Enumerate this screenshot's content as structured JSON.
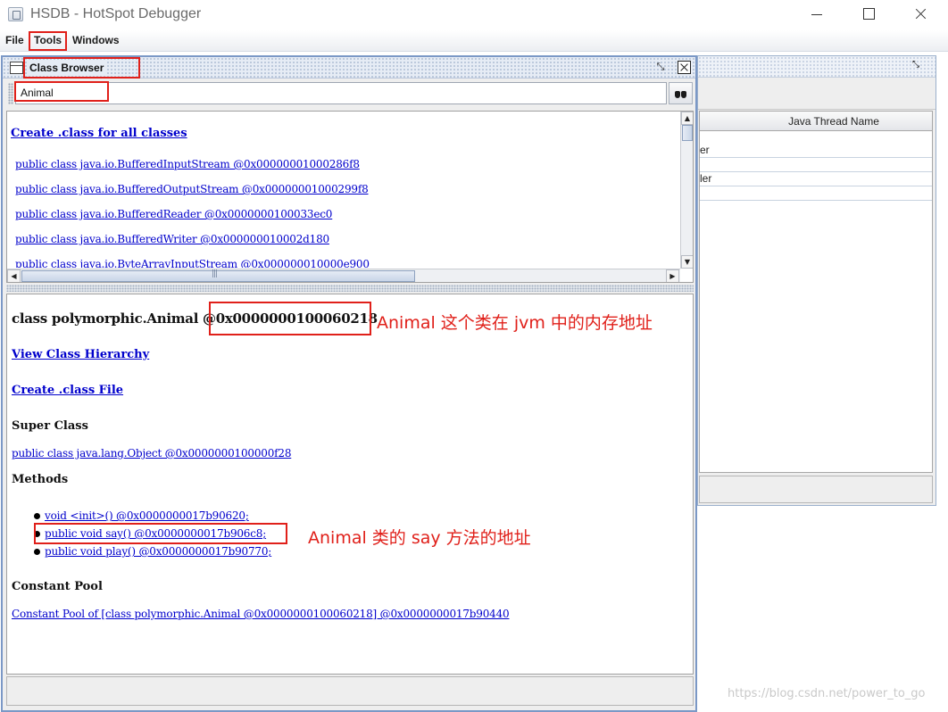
{
  "window": {
    "title": "HSDB - HotSpot Debugger"
  },
  "menu": {
    "file": "File",
    "tools": "Tools",
    "windows": "Windows"
  },
  "threads_frame": {
    "column_header": "Java Thread Name",
    "rows": [
      "er",
      "",
      "ler"
    ]
  },
  "class_browser": {
    "title": "Class Browser",
    "search": {
      "value": "Animal"
    },
    "create_all_link": "Create .class for all classes",
    "class_list": [
      "public class java.io.BufferedInputStream @0x00000001000286f8",
      "public class java.io.BufferedOutputStream @0x00000001000299f8",
      "public class java.io.BufferedReader @0x0000000100033ec0",
      "public class java.io.BufferedWriter @0x000000010002d180",
      "public class java.io.ByteArrayInputStream @0x000000010000e900"
    ],
    "detail": {
      "class_prefix": "class polymorphic.Animal @",
      "class_address": "0x0000000100060218",
      "view_hierarchy": "View Class Hierarchy",
      "create_class_file": "Create .class File",
      "super_class_heading": "Super Class",
      "super_class_link": "public class java.lang.Object @0x0000000100000f28",
      "methods_heading": "Methods",
      "methods": [
        "void <init>() @0x0000000017b90620;",
        "public void say() @0x0000000017b906c8;",
        "public void play() @0x0000000017b90770;"
      ],
      "constant_pool_heading": "Constant Pool",
      "constant_pool_link": "Constant Pool of [class polymorphic.Animal @0x0000000100060218] @0x0000000017b90440"
    }
  },
  "annotations": {
    "address_note": "Animal 这个类在 jvm 中的内存地址",
    "method_note": "Animal 类的 say 方法的地址"
  },
  "watermark": "https://blog.csdn.net/power_to_go",
  "colors": {
    "annotation": "#e0201a",
    "link": "#0000cc",
    "frame_border": "#7b98c6"
  }
}
